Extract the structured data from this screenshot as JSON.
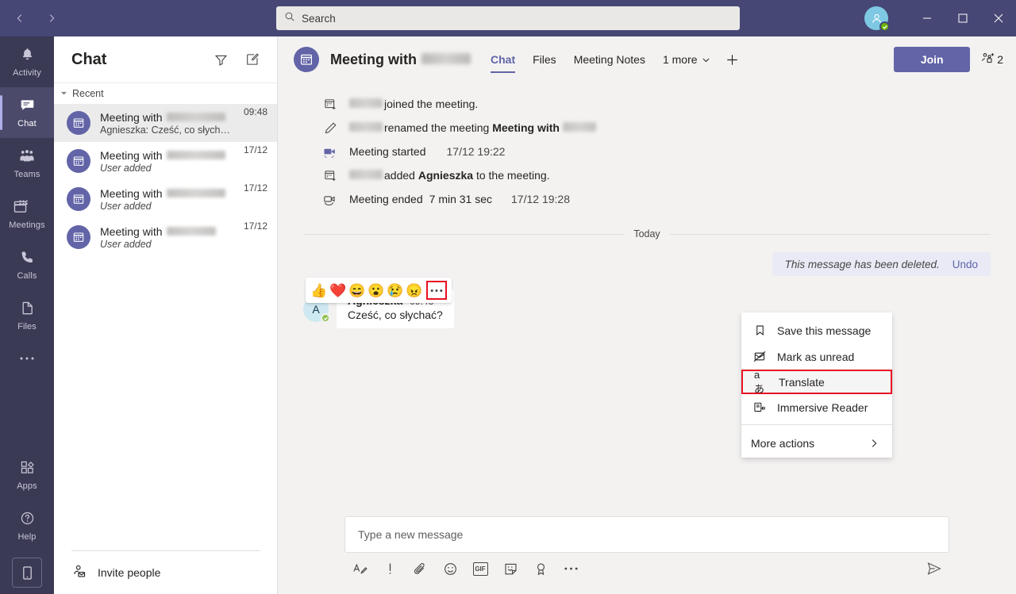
{
  "titlebar": {
    "back_icon": "chevron-left-icon",
    "forward_icon": "chevron-right-icon",
    "search_placeholder": "Search",
    "search_value": "",
    "minimize_label": "Minimize",
    "maximize_label": "Maximize",
    "close_label": "Close",
    "accent": "#464775",
    "presence_color": "#6bb700"
  },
  "rail": {
    "items": [
      {
        "label": "Activity",
        "icon": "bell-icon",
        "active": false
      },
      {
        "label": "Chat",
        "icon": "chat-bubble-icon",
        "active": true
      },
      {
        "label": "Teams",
        "icon": "people-icon",
        "active": false
      },
      {
        "label": "Meetings",
        "icon": "calendar-icon",
        "active": false
      },
      {
        "label": "Calls",
        "icon": "phone-icon",
        "active": false
      },
      {
        "label": "Files",
        "icon": "file-icon",
        "active": false
      },
      {
        "label": "",
        "icon": "more-horizontal-icon",
        "active": false
      }
    ],
    "bottom": [
      {
        "label": "Apps",
        "icon": "apps-icon"
      },
      {
        "label": "Help",
        "icon": "help-circle-icon"
      }
    ],
    "mobile_icon": "mobile-phone-icon"
  },
  "chatlist": {
    "title": "Chat",
    "filter_icon": "filter-icon",
    "compose_icon": "new-chat-icon",
    "section_label": "Recent",
    "items": [
      {
        "name": "Meeting with",
        "redact_width": 74,
        "preview": "Agnieszka: Cześć, co słychać?",
        "preview_italic": false,
        "time": "09:48",
        "selected": true
      },
      {
        "name": "Meeting with",
        "redact_width": 74,
        "preview": "User added",
        "preview_italic": true,
        "time": "17/12",
        "selected": false
      },
      {
        "name": "Meeting with",
        "redact_width": 74,
        "preview": "User added",
        "preview_italic": true,
        "time": "17/12",
        "selected": false
      },
      {
        "name": "Meeting with",
        "redact_width": 62,
        "preview": "User added",
        "preview_italic": true,
        "time": "17/12",
        "selected": false
      }
    ],
    "invite_label": "Invite people",
    "invite_icon": "add-person-icon"
  },
  "header": {
    "title": "Meeting with",
    "avatar_icon": "calendar-icon",
    "tabs": [
      {
        "label": "Chat",
        "active": true
      },
      {
        "label": "Files",
        "active": false
      },
      {
        "label": "Meeting Notes",
        "active": false
      },
      {
        "label": "1 more",
        "active": false,
        "has_chevron": true
      }
    ],
    "add_tab_icon": "plus-icon",
    "join_label": "Join",
    "participants_count": "2",
    "participants_icon": "add-people-icon",
    "accent": "#6264a7"
  },
  "conversation": {
    "system_messages": [
      {
        "icon": "calendar-add-icon",
        "redacted": true,
        "text": "joined the meeting.",
        "bold": "",
        "tail": "",
        "time": ""
      },
      {
        "icon": "pencil-icon",
        "redacted": true,
        "text": "renamed the meeting ",
        "bold": "Meeting with",
        "tail_redacted": true,
        "time": ""
      },
      {
        "icon": "video-icon",
        "redacted": false,
        "text": "Meeting started",
        "time": "17/12 19:22"
      },
      {
        "icon": "calendar-add-icon",
        "redacted": true,
        "text_pre": "added ",
        "bold": "Agnieszka",
        "text_post": " to the meeting.",
        "time": ""
      },
      {
        "icon": "video-off-icon",
        "redacted": false,
        "text": "Meeting ended",
        "duration": "7 min 31 sec",
        "time": "17/12 19:28"
      }
    ],
    "day_divider": "Today",
    "reactions": [
      {
        "name": "thumbs-up-reaction",
        "glyph": "👍"
      },
      {
        "name": "heart-reaction",
        "glyph": "❤️"
      },
      {
        "name": "laugh-reaction",
        "glyph": "😄"
      },
      {
        "name": "surprised-reaction",
        "glyph": "😮"
      },
      {
        "name": "sad-reaction",
        "glyph": "😢"
      },
      {
        "name": "angry-reaction",
        "glyph": "😠"
      }
    ],
    "more_options_icon": "more-horizontal-icon",
    "message": {
      "avatar_initial": "A",
      "author": "Agnieszka",
      "time": "09:48",
      "text": "Cześć, co słychać?"
    },
    "deleted_message": {
      "text": "This message has been deleted.",
      "undo_label": "Undo"
    }
  },
  "context_menu": {
    "items": [
      {
        "label": "Save this message",
        "icon": "bookmark-icon",
        "highlight": false
      },
      {
        "label": "Mark as unread",
        "icon": "mark-unread-icon",
        "highlight": false
      },
      {
        "label": "Translate",
        "icon": "translate-icon",
        "glyph": "aあ",
        "highlight": true
      },
      {
        "label": "Immersive Reader",
        "icon": "immersive-reader-icon",
        "highlight": false
      }
    ],
    "more_label": "More actions",
    "more_chevron_icon": "chevron-right-icon",
    "highlight_color": "#e81123"
  },
  "composer": {
    "placeholder": "Type a new message",
    "value": "",
    "tools": [
      {
        "name": "format-icon",
        "label": "Format"
      },
      {
        "name": "important-icon",
        "label": "Set delivery options"
      },
      {
        "name": "attach-icon",
        "label": "Attach"
      },
      {
        "name": "emoji-icon",
        "label": "Emoji"
      },
      {
        "name": "giphy-icon",
        "label": "GIF"
      },
      {
        "name": "sticker-icon",
        "label": "Sticker"
      },
      {
        "name": "praise-icon",
        "label": "Praise"
      },
      {
        "name": "more-horizontal-icon",
        "label": "More options"
      }
    ],
    "send_icon": "send-icon"
  }
}
